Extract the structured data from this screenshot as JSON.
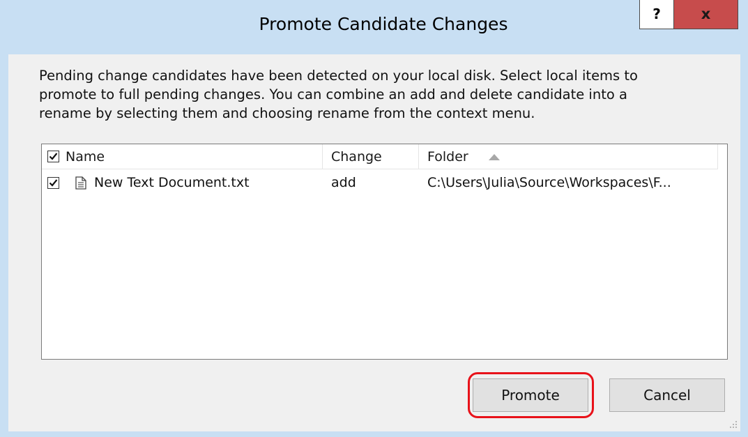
{
  "window": {
    "title": "Promote Candidate Changes",
    "help_label": "?",
    "close_label": "x"
  },
  "description": "Pending change candidates have been detected on your local disk. Select local items to\npromote to full pending changes. You can combine an add and delete candidate into a\nrename by selecting them and choosing rename from the context menu.",
  "list": {
    "columns": [
      "Name",
      "Change",
      "Folder"
    ],
    "sort_column": "Folder",
    "sort_direction": "ascending",
    "header_checked": true,
    "rows": [
      {
        "checked": true,
        "icon": "text-document-icon",
        "name": "New Text Document.txt",
        "change": "add",
        "folder": "C:\\Users\\Julia\\Source\\Workspaces\\F..."
      }
    ]
  },
  "buttons": {
    "promote": "Promote",
    "cancel": "Cancel"
  },
  "colors": {
    "title_bar": "#c8dff3",
    "close_button": "#c74c4c",
    "highlight": "#e8121a"
  }
}
